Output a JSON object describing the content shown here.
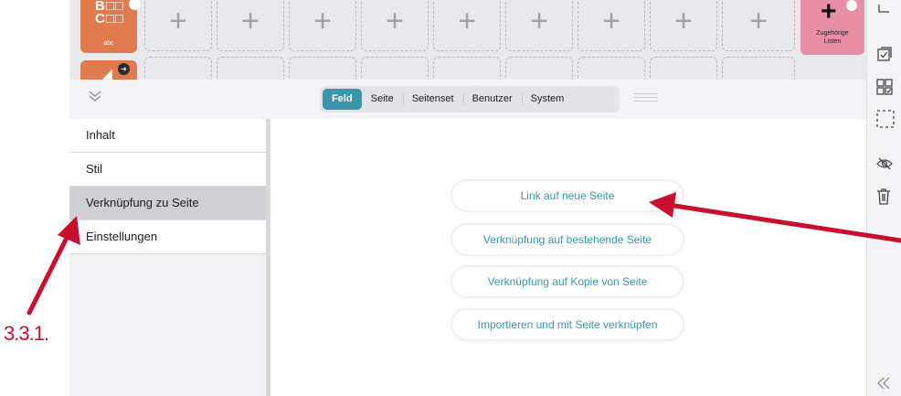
{
  "tiles": {
    "abc_glyphs_row1": "B□□",
    "abc_glyphs_row2": "C□□",
    "abc_label": "abc",
    "related_lists_label_line1": "Zugehörige",
    "related_lists_label_line2": "Listen",
    "empty_slot_symbol": "+"
  },
  "toolbar": {
    "segments": [
      "Feld",
      "Seite",
      "Seitenset",
      "Benutzer",
      "System"
    ],
    "active_segment": "Feld"
  },
  "menu": {
    "items": [
      "Inhalt",
      "Stil",
      "Verknüpfung zu Seite",
      "Einstellungen"
    ],
    "selected": "Verknüpfung zu Seite"
  },
  "actions": [
    "Link auf neue Seite",
    "Verknüpfung auf bestehende Seite",
    "Verknüpfung auf Kopie von Seite",
    "Importieren und mit Seite verknüpfen"
  ],
  "annotation": {
    "label": "3.3.1.",
    "color": "#c8102e"
  },
  "colors": {
    "accent": "#3a96a9",
    "tile_orange": "#e07a4f",
    "tile_pink": "#e88ea6"
  },
  "icons": {
    "toolbar_left": "chevron-double-down-icon",
    "right_sidebar": [
      "copy-icon",
      "checkbox-page-icon",
      "grid-check-icon",
      "dashed-select-icon",
      "hide-eye-icon",
      "trash-icon",
      "chevron-double-left-icon"
    ]
  }
}
